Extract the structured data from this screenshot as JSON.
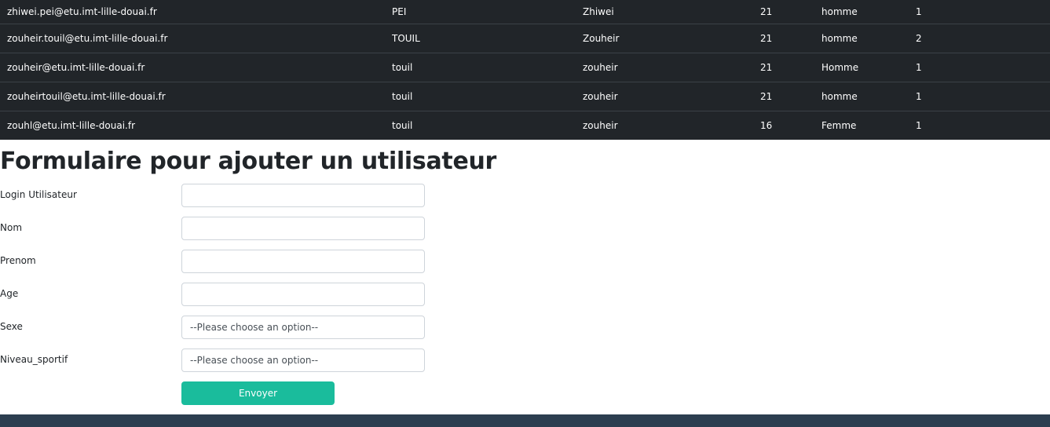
{
  "users_table": {
    "rows": [
      [
        "zhiwei.pei@etu.imt-lille-douai.fr",
        "PEI",
        "Zhiwei",
        "21",
        "homme",
        "1"
      ],
      [
        "zouheir.touil@etu.imt-lille-douai.fr",
        "TOUIL",
        "Zouheir",
        "21",
        "homme",
        "2"
      ],
      [
        "zouheir@etu.imt-lille-douai.fr",
        "touil",
        "zouheir",
        "21",
        "Homme",
        "1"
      ],
      [
        "zouheirtouil@etu.imt-lille-douai.fr",
        "touil",
        "zouheir",
        "21",
        "homme",
        "1"
      ],
      [
        "zouhl@etu.imt-lille-douai.fr",
        "touil",
        "zouheir",
        "16",
        "Femme",
        "1"
      ]
    ]
  },
  "form": {
    "title": "Formulaire pour ajouter un utilisateur",
    "fields": [
      {
        "label": "Login Utilisateur",
        "value": ""
      },
      {
        "label": "Nom",
        "value": ""
      },
      {
        "label": "Prenom",
        "value": ""
      },
      {
        "label": "Age",
        "value": ""
      },
      {
        "label": "Sexe",
        "selected": "--Please choose an option--"
      },
      {
        "label": "Niveau_sportif",
        "selected": "--Please choose an option--"
      }
    ],
    "submit_label": "Envoyer"
  },
  "colors": {
    "table_bg": "#212529",
    "accent": "#1abc9c",
    "footer": "#2c3e50"
  }
}
